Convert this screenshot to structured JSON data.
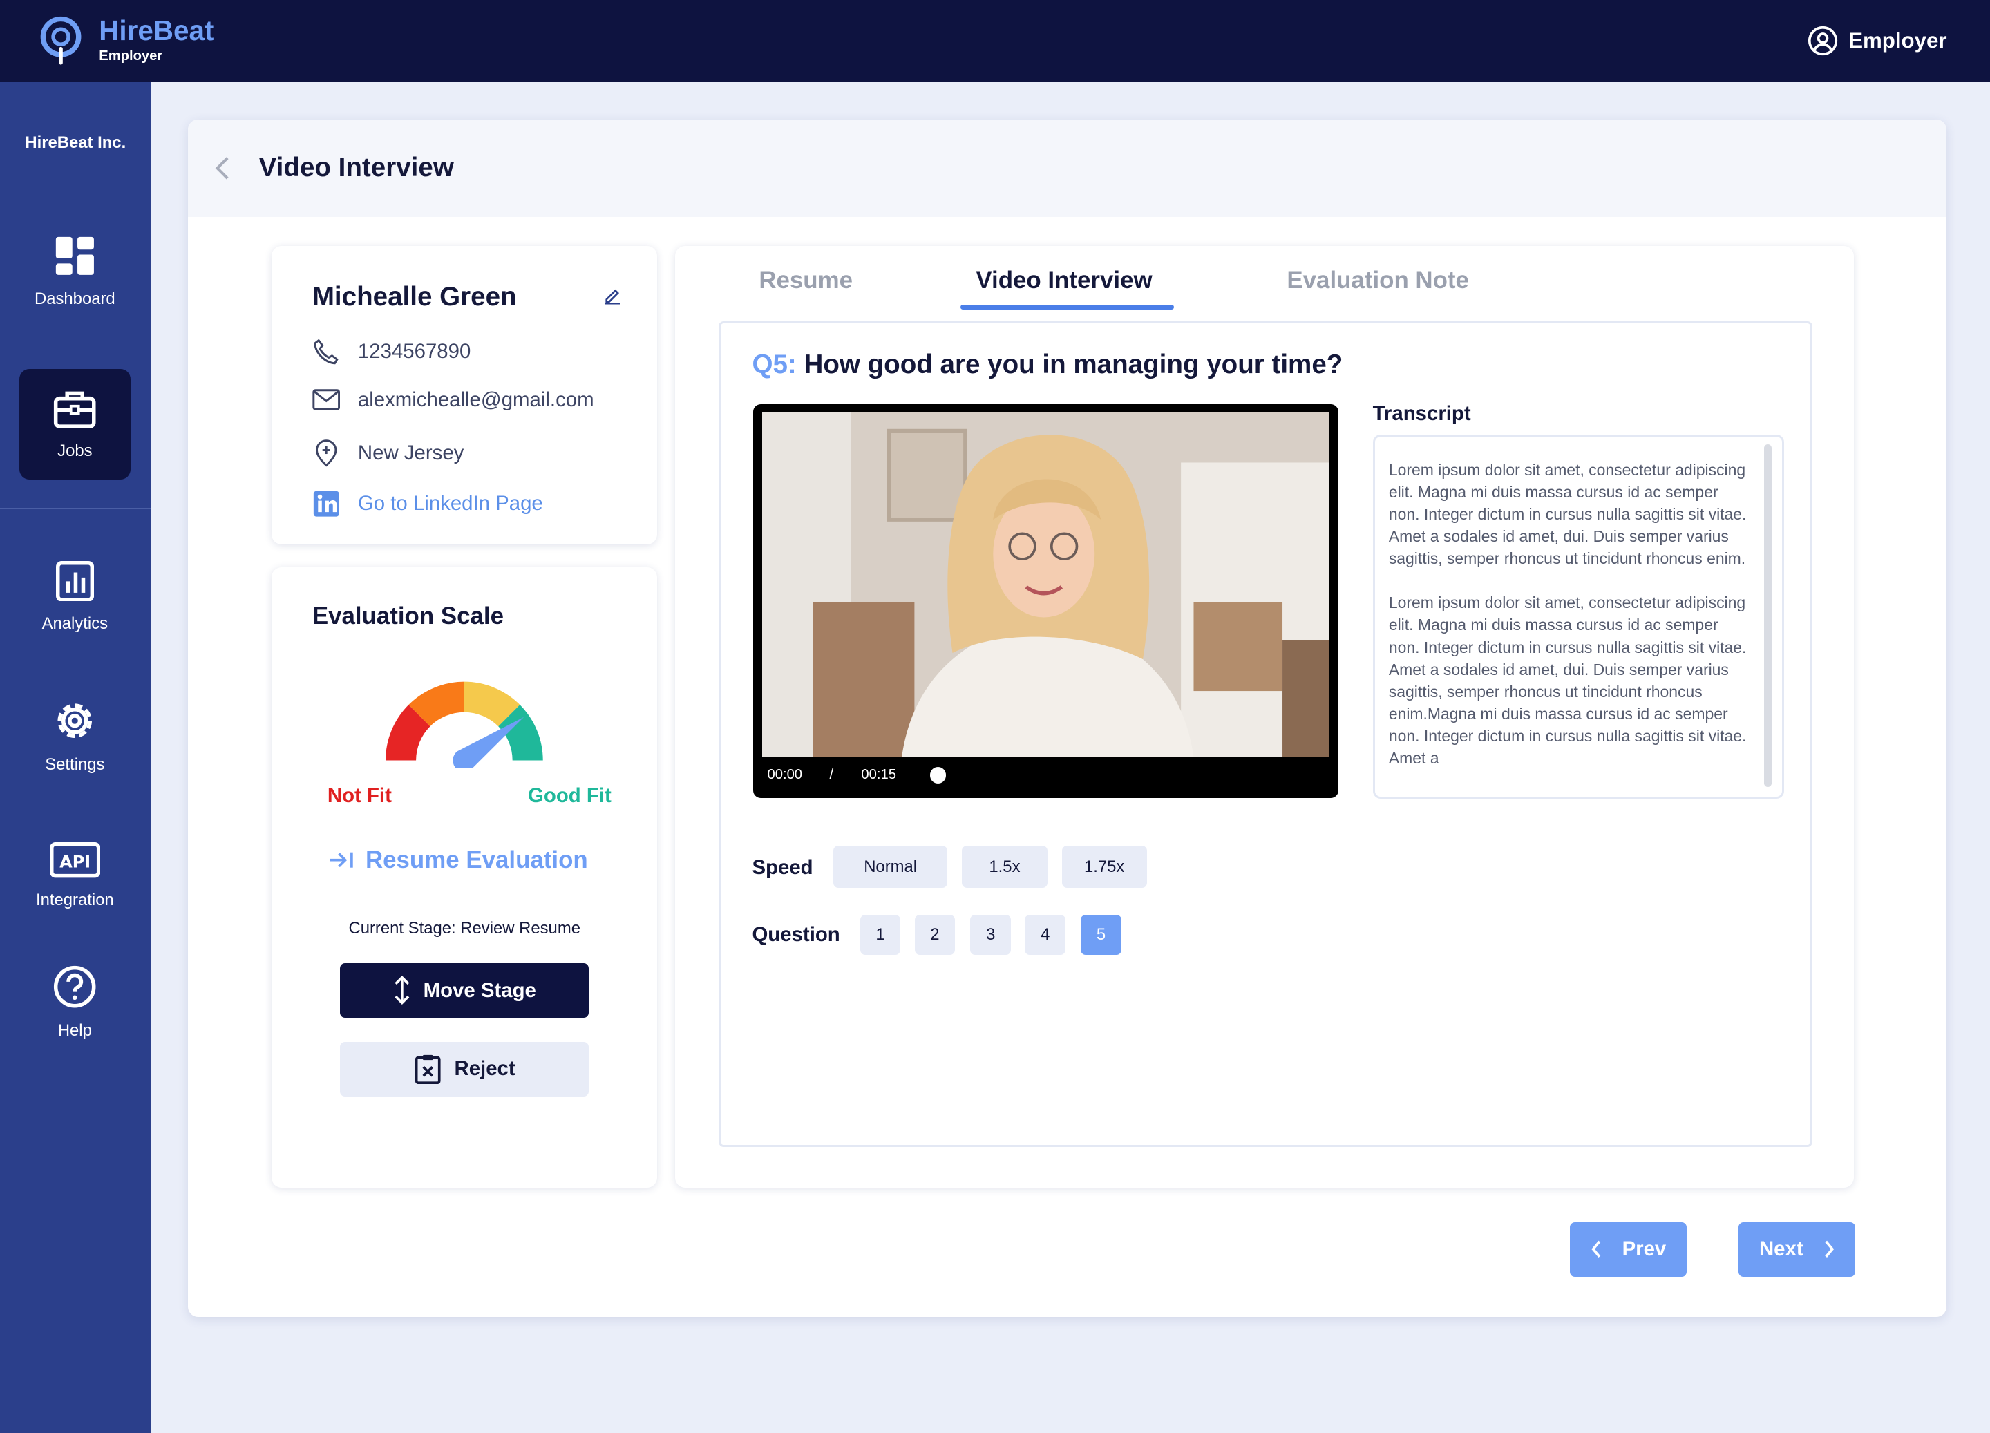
{
  "brand": {
    "name": "HireBeat",
    "sub": "Employer"
  },
  "header": {
    "user_label": "Employer"
  },
  "sidebar": {
    "org": "HireBeat Inc.",
    "items": [
      {
        "label": "Dashboard",
        "icon": "dashboard-icon"
      },
      {
        "label": "Jobs",
        "icon": "briefcase-icon",
        "active": true
      },
      {
        "label": "Analytics",
        "icon": "analytics-icon"
      },
      {
        "label": "Settings",
        "icon": "gear-icon"
      },
      {
        "label": "Integration",
        "icon": "api-icon"
      },
      {
        "label": "Help",
        "icon": "help-icon"
      }
    ]
  },
  "page": {
    "title": "Video Interview"
  },
  "candidate": {
    "name": "Michealle Green",
    "phone": "1234567890",
    "email": "alexmichealle@gmail.com",
    "location": "New Jersey",
    "linkedin_label": "Go to LinkedIn Page"
  },
  "evaluation": {
    "title": "Evaluation Scale",
    "not_fit": "Not Fit",
    "good_fit": "Good Fit",
    "resume_eval": "Resume Evaluation",
    "current_stage": "Current Stage: Review Resume",
    "move_stage": "Move Stage",
    "reject": "Reject",
    "gauge_level": 0.8
  },
  "tabs": [
    {
      "label": "Resume"
    },
    {
      "label": "Video Interview",
      "active": true
    },
    {
      "label": "Evaluation Note"
    }
  ],
  "question": {
    "number": "Q5:",
    "text": "How good are you in managing your time?"
  },
  "video": {
    "time_current": "00:00",
    "separator": "/",
    "time_total": "00:15"
  },
  "transcript": {
    "title": "Transcript",
    "paragraphs": [
      "Lorem ipsum dolor sit amet, consectetur adipiscing elit. Magna mi duis massa cursus id ac semper non. Integer dictum in cursus nulla sagittis sit vitae. Amet a sodales id amet, dui. Duis semper varius sagittis, semper rhoncus ut tincidunt rhoncus enim.",
      "Lorem ipsum dolor sit amet, consectetur adipiscing elit. Magna mi duis massa cursus id ac semper non. Integer dictum in cursus nulla sagittis sit vitae. Amet a sodales id amet, dui. Duis semper varius sagittis, semper rhoncus ut tincidunt rhoncus enim.Magna mi duis massa cursus id ac semper non. Integer dictum in cursus nulla sagittis sit vitae. Amet a"
    ]
  },
  "speed": {
    "label": "Speed",
    "options": [
      "Normal",
      "1.5x",
      "1.75x"
    ]
  },
  "questions": {
    "label": "Question",
    "options": [
      "1",
      "2",
      "3",
      "4",
      "5"
    ],
    "selected": "5"
  },
  "pager": {
    "prev": "Prev",
    "next": "Next"
  },
  "colors": {
    "navy": "#0e1340",
    "sidebar": "#2b3f8b",
    "accent": "#6f9ef5",
    "not_fit": "#e02020",
    "good_fit": "#1fb89a"
  }
}
